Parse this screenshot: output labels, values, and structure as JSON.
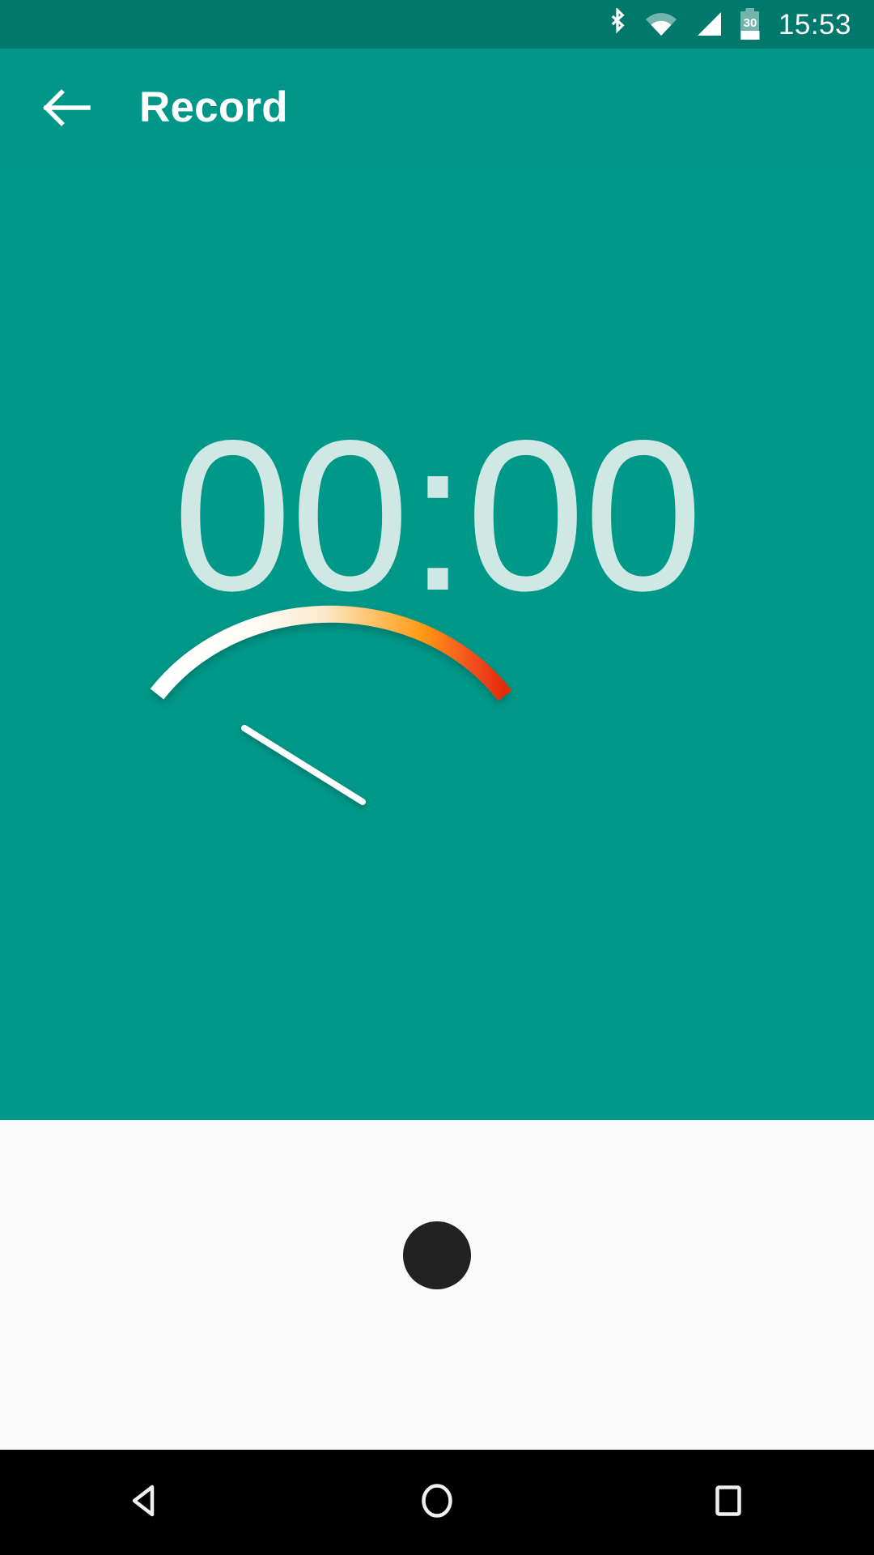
{
  "status_bar": {
    "time": "15:53",
    "battery_level": "30",
    "icons": [
      "bluetooth-icon",
      "wifi-icon",
      "cellular-signal-icon",
      "battery-icon"
    ],
    "background_color": "#00786B"
  },
  "app_bar": {
    "title": "Record",
    "back_icon": "back-arrow-icon",
    "background_color": "#009688",
    "title_color": "#FFFFFF"
  },
  "content": {
    "timer": "00:00",
    "timer_color": "#CFE8E3",
    "background_color": "#009888",
    "vu_meter": {
      "name": "vu-meter-gauge",
      "needle_color": "#FFFFFF",
      "arc_colors": [
        "#FFFFFF",
        "#FAF0DC",
        "#FFC266",
        "#FF9800",
        "#F4511E",
        "#E53210"
      ],
      "needle_value_percent": 8
    }
  },
  "bottom_panel": {
    "background_color": "#FAFAFA",
    "record_button": {
      "name": "record-button",
      "color": "#222222",
      "state": "idle"
    }
  },
  "nav_bar": {
    "background_color": "#000000",
    "buttons": [
      {
        "name": "nav-back-button",
        "icon": "triangle-back-icon"
      },
      {
        "name": "nav-home-button",
        "icon": "circle-home-icon"
      },
      {
        "name": "nav-recents-button",
        "icon": "square-recents-icon"
      }
    ]
  }
}
